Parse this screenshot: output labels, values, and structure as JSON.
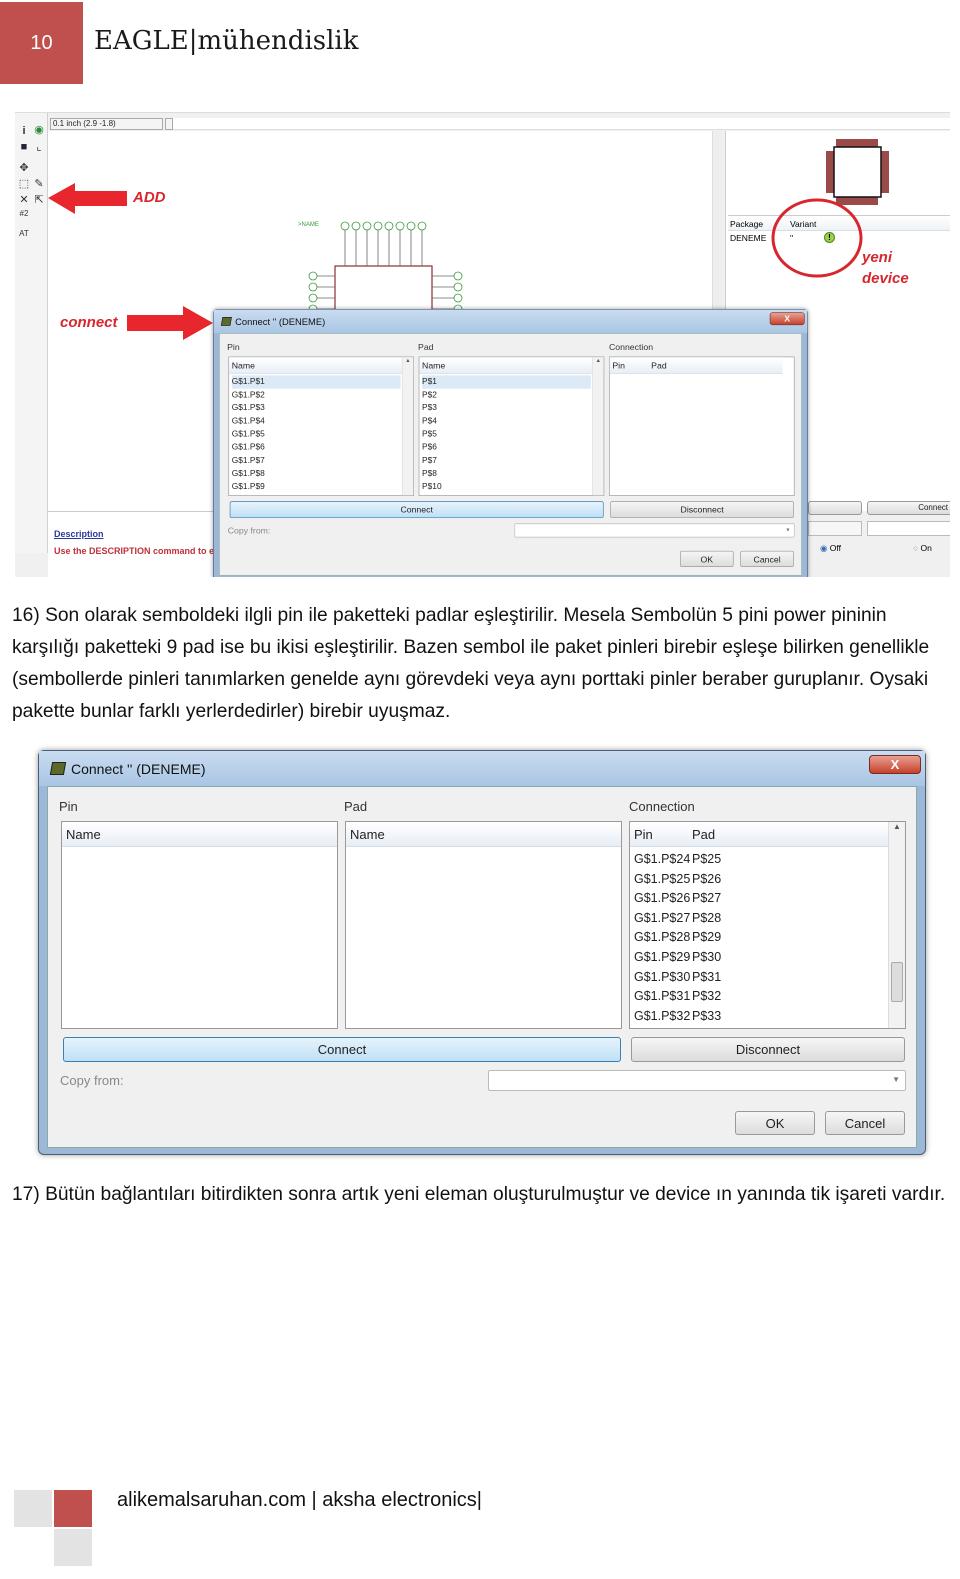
{
  "header": {
    "page_number": "10",
    "title": "EAGLE|mühendislik",
    "accent": "#c0504d"
  },
  "screenshot1": {
    "coord_readout": "0.1 inch (2.9 -1.8)",
    "annotations": {
      "add": "ADD",
      "connect": "connect",
      "new_device_line1": "yeni",
      "new_device_line2": "device"
    },
    "device_table": {
      "headers": [
        "Package",
        "Variant"
      ],
      "row": [
        "DENEME",
        "''"
      ],
      "status_icon": "warning-exclamation-icon"
    },
    "description_title": "Description",
    "description_text": "Use the DESCRIPTION command to ent",
    "side_connect_button": "Connect",
    "radio_off": "Off",
    "radio_on": "On",
    "dialog": {
      "title": "Connect '' (DENEME)",
      "close": "X",
      "pin_label": "Pin",
      "pad_label": "Pad",
      "connection_label": "Connection",
      "name_header": "Name",
      "pin_header": "Pin",
      "pad_header": "Pad",
      "pins": [
        "G$1.P$1",
        "G$1.P$2",
        "G$1.P$3",
        "G$1.P$4",
        "G$1.P$5",
        "G$1.P$6",
        "G$1.P$7",
        "G$1.P$8",
        "G$1.P$9"
      ],
      "pads": [
        "P$1",
        "P$2",
        "P$3",
        "P$4",
        "P$5",
        "P$6",
        "P$7",
        "P$8",
        "P$10"
      ],
      "connections": [],
      "connect": "Connect",
      "disconnect": "Disconnect",
      "copy_from": "Copy from:",
      "ok": "OK",
      "cancel": "Cancel"
    }
  },
  "paragraph16": "16) Son olarak semboldeki ilgli pin ile paketteki padlar eşleştirilir. Mesela Sembolün 5 pini power pininin karşılığı paketteki 9 pad ise bu ikisi eşleştirilir. Bazen sembol ile paket pinleri birebir eşleşe bilirken genellikle (sembollerde pinleri tanımlarken genelde aynı görevdeki veya aynı porttaki pinler beraber guruplanır. Oysaki pakette bunlar farklı yerlerdedirler) birebir uyuşmaz.",
  "dialog2": {
    "title": "Connect '' (DENEME)",
    "close": "X",
    "pin_label": "Pin",
    "pad_label": "Pad",
    "connection_label": "Connection",
    "name_header": "Name",
    "pin_header": "Pin",
    "pad_header": "Pad",
    "pins": [],
    "pads": [],
    "connections": [
      [
        "G$1.P$24",
        "P$25"
      ],
      [
        "G$1.P$25",
        "P$26"
      ],
      [
        "G$1.P$26",
        "P$27"
      ],
      [
        "G$1.P$27",
        "P$28"
      ],
      [
        "G$1.P$28",
        "P$29"
      ],
      [
        "G$1.P$29",
        "P$30"
      ],
      [
        "G$1.P$30",
        "P$31"
      ],
      [
        "G$1.P$31",
        "P$32"
      ],
      [
        "G$1.P$32",
        "P$33"
      ]
    ],
    "connect": "Connect",
    "disconnect": "Disconnect",
    "copy_from": "Copy from:",
    "ok": "OK",
    "cancel": "Cancel"
  },
  "paragraph17": "17) Bütün bağlantıları bitirdikten sonra artık yeni eleman oluşturulmuştur ve device ın yanında tik işareti vardır.",
  "footer": {
    "text": "alikemalsaruhan.com | aksha electronics|"
  }
}
